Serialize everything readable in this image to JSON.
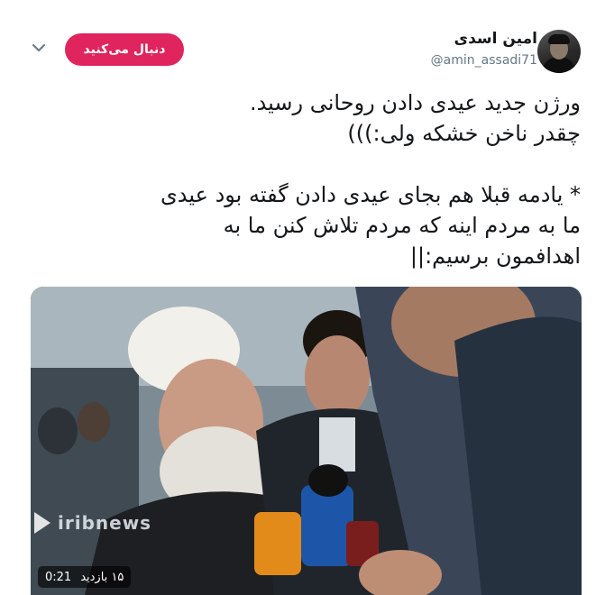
{
  "user": {
    "name": "امین اسدی",
    "handle": "@amin_assadi71"
  },
  "actions": {
    "follow_label": "دنبال می‌کنید"
  },
  "tweet": {
    "lines": [
      "ورژن جدید عیدی دادن روحانی رسید.",
      "چقدر ناخن خشکه ولی:)))",
      "* یادمه قبلا هم بجای عیدی دادن گفته بود عیدی",
      "ما به مردم اینه که مردم تلاش کنن ما به",
      "اهدافمون برسیم:||"
    ]
  },
  "media": {
    "watermark": "iribnews",
    "duration": "0:21",
    "views": "۱۵ بازدید"
  },
  "colors": {
    "follow_button": "#e0245e",
    "handle_text": "#657786"
  }
}
